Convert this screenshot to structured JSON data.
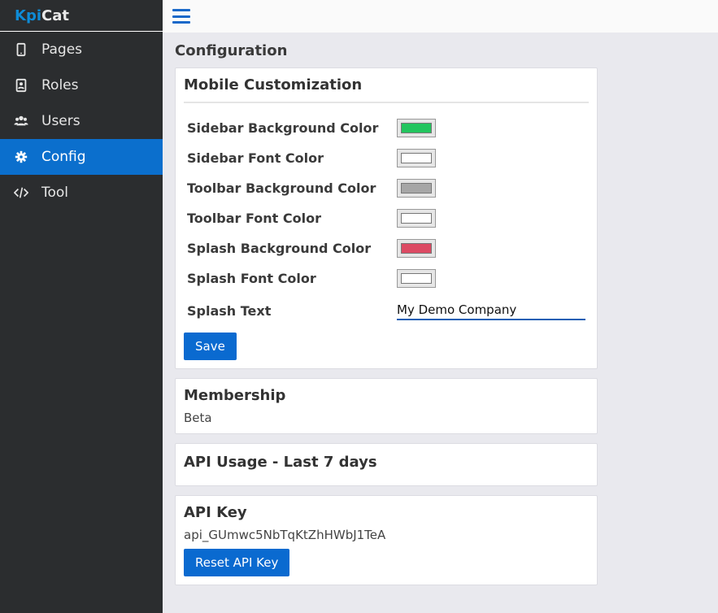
{
  "brand": {
    "part1": "Kpi",
    "part2": "Cat",
    "accent": "#0e8bd6"
  },
  "sidebar": {
    "items": [
      {
        "label": "Pages",
        "icon": "tablet-icon"
      },
      {
        "label": "Roles",
        "icon": "id-badge-icon"
      },
      {
        "label": "Users",
        "icon": "users-icon"
      },
      {
        "label": "Config",
        "icon": "gear-icon",
        "active": true
      },
      {
        "label": "Tool",
        "icon": "code-icon"
      }
    ]
  },
  "page": {
    "title": "Configuration"
  },
  "mobile": {
    "title": "Mobile Customization",
    "fields": [
      {
        "label": "Sidebar Background Color",
        "color": "#22c55e"
      },
      {
        "label": "Sidebar Font Color",
        "color": "#ffffff"
      },
      {
        "label": "Toolbar Background Color",
        "color": "#a6a6a6"
      },
      {
        "label": "Toolbar Font Color",
        "color": "#ffffff"
      },
      {
        "label": "Splash Background Color",
        "color": "#dc4a63"
      },
      {
        "label": "Splash Font Color",
        "color": "#ffffff"
      }
    ],
    "splash_text_label": "Splash Text",
    "splash_text_value": "My Demo Company",
    "save_label": "Save"
  },
  "membership": {
    "title": "Membership",
    "value": "Beta"
  },
  "api_usage": {
    "title": "API Usage - Last 7 days"
  },
  "api_key": {
    "title": "API Key",
    "value": "api_GUmwc5NbTqKtZhHWbJ1TeA",
    "reset_label": "Reset API Key"
  }
}
